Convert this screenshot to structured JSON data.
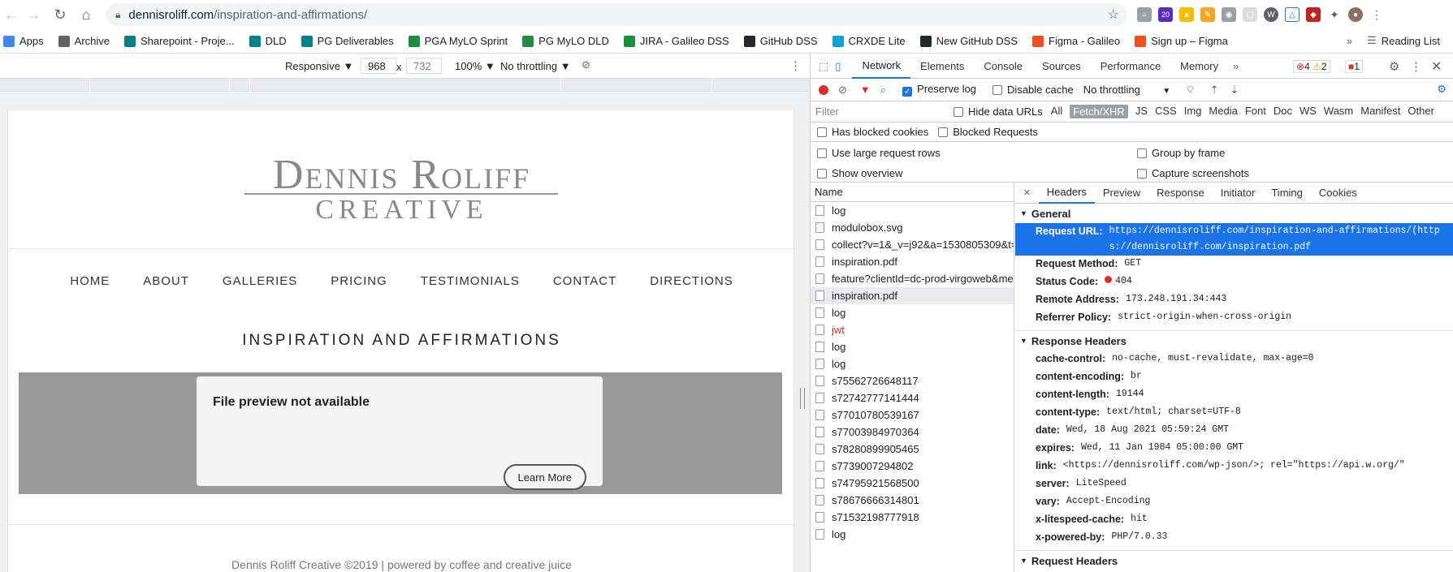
{
  "browser": {
    "url_host": "dennisroliff.com",
    "url_path": "/inspiration-and-affirmations/",
    "bookmarks": [
      {
        "label": "Apps",
        "color": "#4285f4"
      },
      {
        "label": "Archive",
        "color": "#5f6368"
      },
      {
        "label": "Sharepoint - Proje...",
        "color": "#038387"
      },
      {
        "label": "DLD",
        "color": "#038387"
      },
      {
        "label": "PG Deliverables",
        "color": "#038387"
      },
      {
        "label": "PGA MyLO Sprint",
        "color": "#1e8e3e"
      },
      {
        "label": "PG MyLO DLD",
        "color": "#1e8e3e"
      },
      {
        "label": "JIRA - Galileo DSS",
        "color": "#1e8e3e"
      },
      {
        "label": "GitHub DSS",
        "color": "#24292e"
      },
      {
        "label": "CRXDE Lite",
        "color": "#12a4d9"
      },
      {
        "label": "New GitHub DSS",
        "color": "#24292e"
      },
      {
        "label": "Figma - Galileo",
        "color": "#f24e1e"
      },
      {
        "label": "Sign up – Figma",
        "color": "#f24e1e"
      }
    ],
    "reading_list": "Reading List",
    "ext_badge": "20"
  },
  "device_toolbar": {
    "mode": "Responsive ▼",
    "width": "968",
    "times": "x",
    "height": "732",
    "zoom": "100% ▼",
    "throttle": "No throttling ▼"
  },
  "site": {
    "logo_top": "Dennis Roliff",
    "logo_bottom": "CREATIVE",
    "menu": [
      "HOME",
      "ABOUT",
      "GALLERIES",
      "PRICING",
      "TESTIMONIALS",
      "CONTACT",
      "DIRECTIONS"
    ],
    "page_title": "INSPIRATION AND AFFIRMATIONS",
    "preview_title": "File preview not available",
    "learn_more": "Learn More",
    "footer": "Dennis Roliff Creative ©2019 | powered by coffee and creative juice"
  },
  "devtools": {
    "tabs": [
      "Network",
      "Elements",
      "Console",
      "Sources",
      "Performance",
      "Memory"
    ],
    "more": "»",
    "err_count": "4",
    "warn_count": "2",
    "issue_count": "1",
    "preserve_log": "Preserve log",
    "disable_cache": "Disable cache",
    "throttling": "No throttling",
    "filter_placeholder": "Filter",
    "hide_data_urls": "Hide data URLs",
    "filter_types": [
      "All",
      "Fetch/XHR",
      "JS",
      "CSS",
      "Img",
      "Media",
      "Font",
      "Doc",
      "WS",
      "Wasm",
      "Manifest",
      "Other"
    ],
    "has_blocked": "Has blocked cookies",
    "blocked_requests": "Blocked Requests",
    "large_rows": "Use large request rows",
    "group_by_frame": "Group by frame",
    "show_overview": "Show overview",
    "capture_screenshots": "Capture screenshots",
    "name_header": "Name",
    "requests": [
      {
        "name": "log",
        "selected": false,
        "error": false
      },
      {
        "name": "modulobox.svg",
        "selected": false,
        "error": false
      },
      {
        "name": "collect?v=1&_v=j92&a=1530805309&t=...",
        "selected": false,
        "error": false
      },
      {
        "name": "inspiration.pdf",
        "selected": false,
        "error": false
      },
      {
        "name": "feature?clientId=dc-prod-virgoweb&me...",
        "selected": false,
        "error": false
      },
      {
        "name": "inspiration.pdf",
        "selected": true,
        "error": false
      },
      {
        "name": "log",
        "selected": false,
        "error": false
      },
      {
        "name": "jwt",
        "selected": false,
        "error": true
      },
      {
        "name": "log",
        "selected": false,
        "error": false
      },
      {
        "name": "log",
        "selected": false,
        "error": false
      },
      {
        "name": "s75562726648117",
        "selected": false,
        "error": false
      },
      {
        "name": "s72742777141444",
        "selected": false,
        "error": false
      },
      {
        "name": "s77010780539167",
        "selected": false,
        "error": false
      },
      {
        "name": "s77003984970364",
        "selected": false,
        "error": false
      },
      {
        "name": "s78280899905465",
        "selected": false,
        "error": false
      },
      {
        "name": "s7739007294802",
        "selected": false,
        "error": false
      },
      {
        "name": "s74795921568500",
        "selected": false,
        "error": false
      },
      {
        "name": "s78676666314801",
        "selected": false,
        "error": false
      },
      {
        "name": "s71532198777918",
        "selected": false,
        "error": false
      },
      {
        "name": "log",
        "selected": false,
        "error": false
      }
    ],
    "detail_close": "×",
    "detail_tabs": [
      "Headers",
      "Preview",
      "Response",
      "Initiator",
      "Timing",
      "Cookies"
    ],
    "general_title": "General",
    "general": {
      "request_url_k": "Request URL:",
      "request_url_v": "https://dennisroliff.com/inspiration-and-affirmations/(https://dennisroliff.com/inspiration.pdf",
      "method_k": "Request Method:",
      "method_v": "GET",
      "status_k": "Status Code:",
      "status_v": "404",
      "remote_k": "Remote Address:",
      "remote_v": "173.248.191.34:443",
      "referrer_k": "Referrer Policy:",
      "referrer_v": "strict-origin-when-cross-origin"
    },
    "response_title": "Response Headers",
    "response_headers": [
      {
        "k": "cache-control:",
        "v": "no-cache, must-revalidate, max-age=0"
      },
      {
        "k": "content-encoding:",
        "v": "br"
      },
      {
        "k": "content-length:",
        "v": "19144"
      },
      {
        "k": "content-type:",
        "v": "text/html; charset=UTF-8"
      },
      {
        "k": "date:",
        "v": "Wed, 18 Aug 2021 05:59:24 GMT"
      },
      {
        "k": "expires:",
        "v": "Wed, 11 Jan 1984 05:00:00 GMT"
      },
      {
        "k": "link:",
        "v": "<https://dennisroliff.com/wp-json/>; rel=\"https://api.w.org/\""
      },
      {
        "k": "server:",
        "v": "LiteSpeed"
      },
      {
        "k": "vary:",
        "v": "Accept-Encoding"
      },
      {
        "k": "x-litespeed-cache:",
        "v": "hit"
      },
      {
        "k": "x-powered-by:",
        "v": "PHP/7.0.33"
      }
    ],
    "request_title": "Request Headers"
  }
}
